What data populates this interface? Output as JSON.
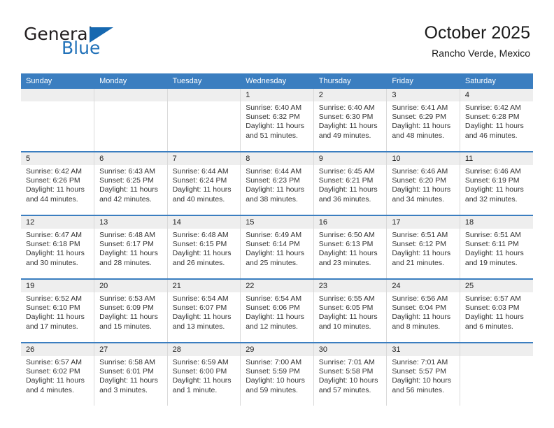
{
  "brand": {
    "name_top": "General",
    "name_bottom": "Blue",
    "color_dark": "#231f20",
    "color_blue": "#2272b9",
    "triangle_color": "#1668b0"
  },
  "header": {
    "title": "October 2025",
    "subtitle": "Rancho Verde, Mexico"
  },
  "theme": {
    "header_bg": "#3b7ec0",
    "header_text": "#ffffff",
    "daynum_band_bg": "#eeeeee",
    "row_divider": "#3b7ec0",
    "cell_divider": "#d9d9d9",
    "body_text": "#333333"
  },
  "weekdays": [
    "Sunday",
    "Monday",
    "Tuesday",
    "Wednesday",
    "Thursday",
    "Friday",
    "Saturday"
  ],
  "weeks": [
    [
      {
        "day": "",
        "empty": true
      },
      {
        "day": "",
        "empty": true
      },
      {
        "day": "",
        "empty": true
      },
      {
        "day": "1",
        "sunrise": "Sunrise: 6:40 AM",
        "sunset": "Sunset: 6:32 PM",
        "daylight": "Daylight: 11 hours and 51 minutes."
      },
      {
        "day": "2",
        "sunrise": "Sunrise: 6:40 AM",
        "sunset": "Sunset: 6:30 PM",
        "daylight": "Daylight: 11 hours and 49 minutes."
      },
      {
        "day": "3",
        "sunrise": "Sunrise: 6:41 AM",
        "sunset": "Sunset: 6:29 PM",
        "daylight": "Daylight: 11 hours and 48 minutes."
      },
      {
        "day": "4",
        "sunrise": "Sunrise: 6:42 AM",
        "sunset": "Sunset: 6:28 PM",
        "daylight": "Daylight: 11 hours and 46 minutes."
      }
    ],
    [
      {
        "day": "5",
        "sunrise": "Sunrise: 6:42 AM",
        "sunset": "Sunset: 6:26 PM",
        "daylight": "Daylight: 11 hours and 44 minutes."
      },
      {
        "day": "6",
        "sunrise": "Sunrise: 6:43 AM",
        "sunset": "Sunset: 6:25 PM",
        "daylight": "Daylight: 11 hours and 42 minutes."
      },
      {
        "day": "7",
        "sunrise": "Sunrise: 6:44 AM",
        "sunset": "Sunset: 6:24 PM",
        "daylight": "Daylight: 11 hours and 40 minutes."
      },
      {
        "day": "8",
        "sunrise": "Sunrise: 6:44 AM",
        "sunset": "Sunset: 6:23 PM",
        "daylight": "Daylight: 11 hours and 38 minutes."
      },
      {
        "day": "9",
        "sunrise": "Sunrise: 6:45 AM",
        "sunset": "Sunset: 6:21 PM",
        "daylight": "Daylight: 11 hours and 36 minutes."
      },
      {
        "day": "10",
        "sunrise": "Sunrise: 6:46 AM",
        "sunset": "Sunset: 6:20 PM",
        "daylight": "Daylight: 11 hours and 34 minutes."
      },
      {
        "day": "11",
        "sunrise": "Sunrise: 6:46 AM",
        "sunset": "Sunset: 6:19 PM",
        "daylight": "Daylight: 11 hours and 32 minutes."
      }
    ],
    [
      {
        "day": "12",
        "sunrise": "Sunrise: 6:47 AM",
        "sunset": "Sunset: 6:18 PM",
        "daylight": "Daylight: 11 hours and 30 minutes."
      },
      {
        "day": "13",
        "sunrise": "Sunrise: 6:48 AM",
        "sunset": "Sunset: 6:17 PM",
        "daylight": "Daylight: 11 hours and 28 minutes."
      },
      {
        "day": "14",
        "sunrise": "Sunrise: 6:48 AM",
        "sunset": "Sunset: 6:15 PM",
        "daylight": "Daylight: 11 hours and 26 minutes."
      },
      {
        "day": "15",
        "sunrise": "Sunrise: 6:49 AM",
        "sunset": "Sunset: 6:14 PM",
        "daylight": "Daylight: 11 hours and 25 minutes."
      },
      {
        "day": "16",
        "sunrise": "Sunrise: 6:50 AM",
        "sunset": "Sunset: 6:13 PM",
        "daylight": "Daylight: 11 hours and 23 minutes."
      },
      {
        "day": "17",
        "sunrise": "Sunrise: 6:51 AM",
        "sunset": "Sunset: 6:12 PM",
        "daylight": "Daylight: 11 hours and 21 minutes."
      },
      {
        "day": "18",
        "sunrise": "Sunrise: 6:51 AM",
        "sunset": "Sunset: 6:11 PM",
        "daylight": "Daylight: 11 hours and 19 minutes."
      }
    ],
    [
      {
        "day": "19",
        "sunrise": "Sunrise: 6:52 AM",
        "sunset": "Sunset: 6:10 PM",
        "daylight": "Daylight: 11 hours and 17 minutes."
      },
      {
        "day": "20",
        "sunrise": "Sunrise: 6:53 AM",
        "sunset": "Sunset: 6:09 PM",
        "daylight": "Daylight: 11 hours and 15 minutes."
      },
      {
        "day": "21",
        "sunrise": "Sunrise: 6:54 AM",
        "sunset": "Sunset: 6:07 PM",
        "daylight": "Daylight: 11 hours and 13 minutes."
      },
      {
        "day": "22",
        "sunrise": "Sunrise: 6:54 AM",
        "sunset": "Sunset: 6:06 PM",
        "daylight": "Daylight: 11 hours and 12 minutes."
      },
      {
        "day": "23",
        "sunrise": "Sunrise: 6:55 AM",
        "sunset": "Sunset: 6:05 PM",
        "daylight": "Daylight: 11 hours and 10 minutes."
      },
      {
        "day": "24",
        "sunrise": "Sunrise: 6:56 AM",
        "sunset": "Sunset: 6:04 PM",
        "daylight": "Daylight: 11 hours and 8 minutes."
      },
      {
        "day": "25",
        "sunrise": "Sunrise: 6:57 AM",
        "sunset": "Sunset: 6:03 PM",
        "daylight": "Daylight: 11 hours and 6 minutes."
      }
    ],
    [
      {
        "day": "26",
        "sunrise": "Sunrise: 6:57 AM",
        "sunset": "Sunset: 6:02 PM",
        "daylight": "Daylight: 11 hours and 4 minutes."
      },
      {
        "day": "27",
        "sunrise": "Sunrise: 6:58 AM",
        "sunset": "Sunset: 6:01 PM",
        "daylight": "Daylight: 11 hours and 3 minutes."
      },
      {
        "day": "28",
        "sunrise": "Sunrise: 6:59 AM",
        "sunset": "Sunset: 6:00 PM",
        "daylight": "Daylight: 11 hours and 1 minute."
      },
      {
        "day": "29",
        "sunrise": "Sunrise: 7:00 AM",
        "sunset": "Sunset: 5:59 PM",
        "daylight": "Daylight: 10 hours and 59 minutes."
      },
      {
        "day": "30",
        "sunrise": "Sunrise: 7:01 AM",
        "sunset": "Sunset: 5:58 PM",
        "daylight": "Daylight: 10 hours and 57 minutes."
      },
      {
        "day": "31",
        "sunrise": "Sunrise: 7:01 AM",
        "sunset": "Sunset: 5:57 PM",
        "daylight": "Daylight: 10 hours and 56 minutes."
      },
      {
        "day": "",
        "empty": true
      }
    ]
  ]
}
